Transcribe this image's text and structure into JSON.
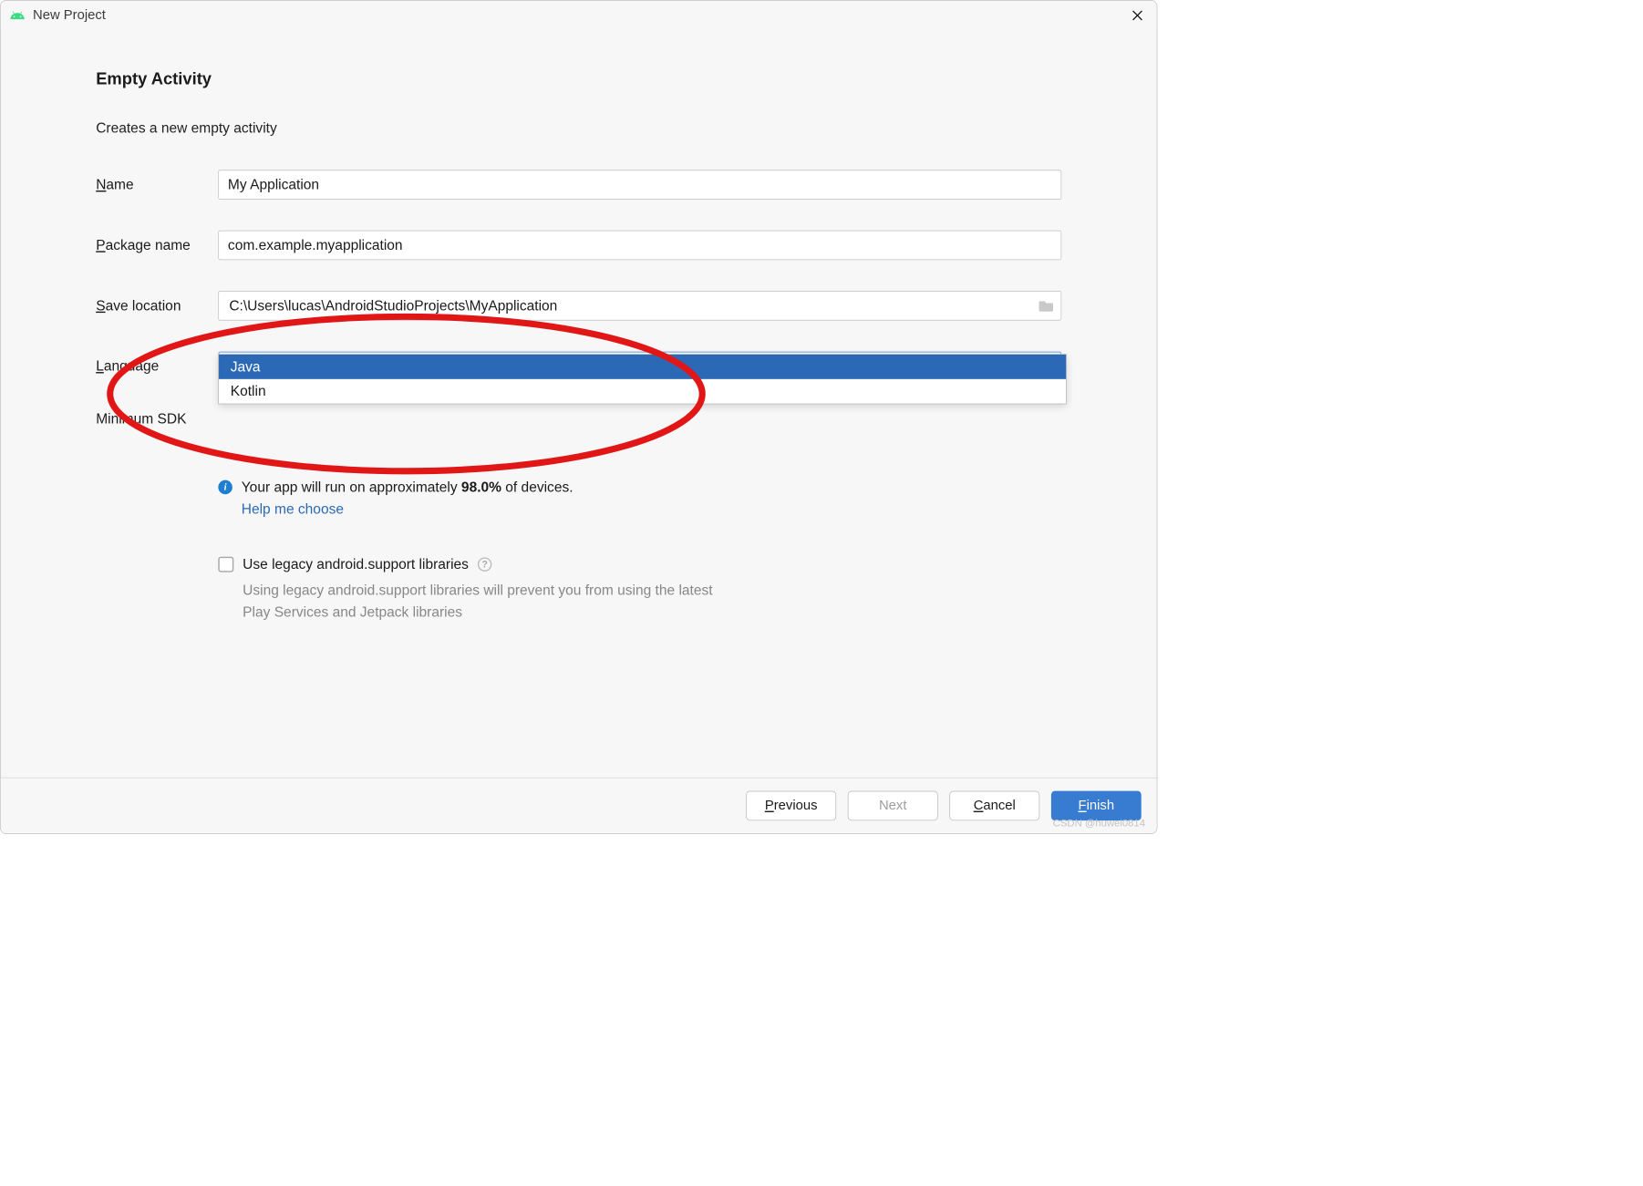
{
  "window": {
    "title": "New Project"
  },
  "header": {
    "heading": "Empty Activity",
    "subtitle": "Creates a new empty activity"
  },
  "form": {
    "name": {
      "label_pre": "N",
      "label_rest": "ame",
      "value": "My Application"
    },
    "package": {
      "label_pre": "P",
      "label_rest": "ackage name",
      "value": "com.example.myapplication"
    },
    "save": {
      "label_pre": "S",
      "label_rest": "ave location",
      "value": "C:\\Users\\lucas\\AndroidStudioProjects\\MyApplication"
    },
    "language": {
      "label_pre": "L",
      "label_rest": "anguage",
      "selected": "Java",
      "options": [
        "Java",
        "Kotlin"
      ]
    },
    "minsdk": {
      "label": "Minimum SDK"
    }
  },
  "info": {
    "text_pre": "Your app will run on approximately ",
    "percent": "98.0%",
    "text_post": " of devices.",
    "help": "Help me choose"
  },
  "legacy": {
    "label": "Use legacy android.support libraries",
    "desc": "Using legacy android.support libraries will prevent you from using the latest Play Services and Jetpack libraries"
  },
  "buttons": {
    "previous_pre": "P",
    "previous_rest": "revious",
    "next": "Next",
    "cancel_pre": "C",
    "cancel_rest": "ancel",
    "finish_pre": "F",
    "finish_rest": "inish"
  },
  "watermark": "CSDN @huwei0814"
}
